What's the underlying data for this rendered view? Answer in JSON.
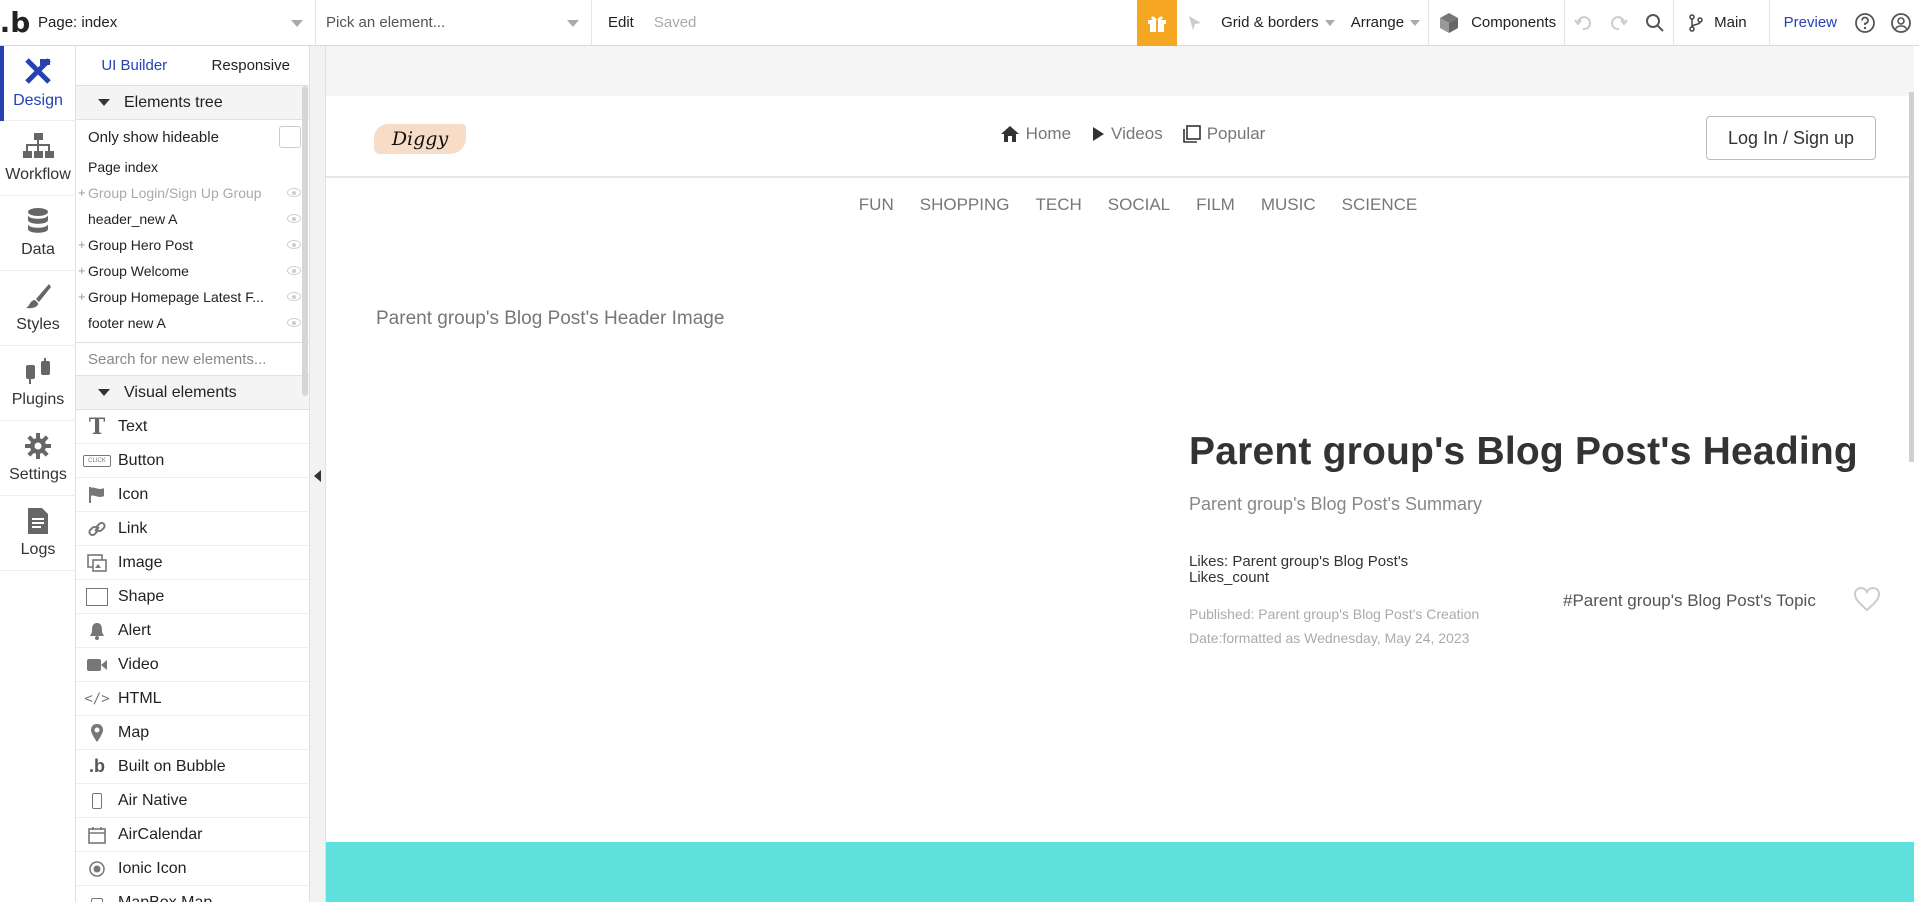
{
  "toolbar": {
    "page_selector": "Page: index",
    "element_picker_placeholder": "Pick an element...",
    "edit_label": "Edit",
    "saved_label": "Saved",
    "grid_label": "Grid & borders",
    "arrange_label": "Arrange",
    "components_label": "Components",
    "branch_label": "Main",
    "preview_label": "Preview"
  },
  "rail": {
    "items": [
      {
        "label": "Design",
        "icon": "design-icon"
      },
      {
        "label": "Workflow",
        "icon": "workflow-icon"
      },
      {
        "label": "Data",
        "icon": "database-icon"
      },
      {
        "label": "Styles",
        "icon": "brush-icon"
      },
      {
        "label": "Plugins",
        "icon": "plug-icon"
      },
      {
        "label": "Settings",
        "icon": "gear-icon"
      },
      {
        "label": "Logs",
        "icon": "document-icon"
      }
    ]
  },
  "panel": {
    "tabs": [
      "UI Builder",
      "Responsive"
    ],
    "elements_tree_label": "Elements tree",
    "only_hideable_label": "Only show hideable",
    "tree": [
      "Page index",
      "Group Login/Sign Up Group",
      "header_new A",
      "Group Hero Post",
      "Group Welcome",
      "Group Homepage Latest F...",
      "footer new A"
    ],
    "search_placeholder": "Search for new elements...",
    "visual_elements_label": "Visual elements",
    "visual_elements": [
      "Text",
      "Button",
      "Icon",
      "Link",
      "Image",
      "Shape",
      "Alert",
      "Video",
      "HTML",
      "Map",
      "Built on Bubble",
      "Air Native",
      "AirCalendar",
      "Ionic Icon",
      "MapBox Map"
    ]
  },
  "canvas": {
    "brand": "Diggy",
    "nav": [
      "Home",
      "Videos",
      "Popular"
    ],
    "login_label": "Log In / Sign up",
    "categories": [
      "FUN",
      "SHOPPING",
      "TECH",
      "SOCIAL",
      "FILM",
      "MUSIC",
      "SCIENCE"
    ],
    "header_image_label": "Parent group's Blog Post's Header Image",
    "heading": "Parent group's Blog Post's Heading",
    "summary": "Parent group's Blog Post's Summary",
    "likes": "Likes: Parent group's Blog Post's Likes_count",
    "published": "Published: Parent group's Blog Post's Creation Date:formatted as Wednesday, May 24, 2023",
    "topic": "#Parent group's Blog Post's Topic"
  },
  "colors": {
    "accent": "#2541b2",
    "gift": "#f5a623",
    "footer_teal": "#5fe0dc"
  }
}
